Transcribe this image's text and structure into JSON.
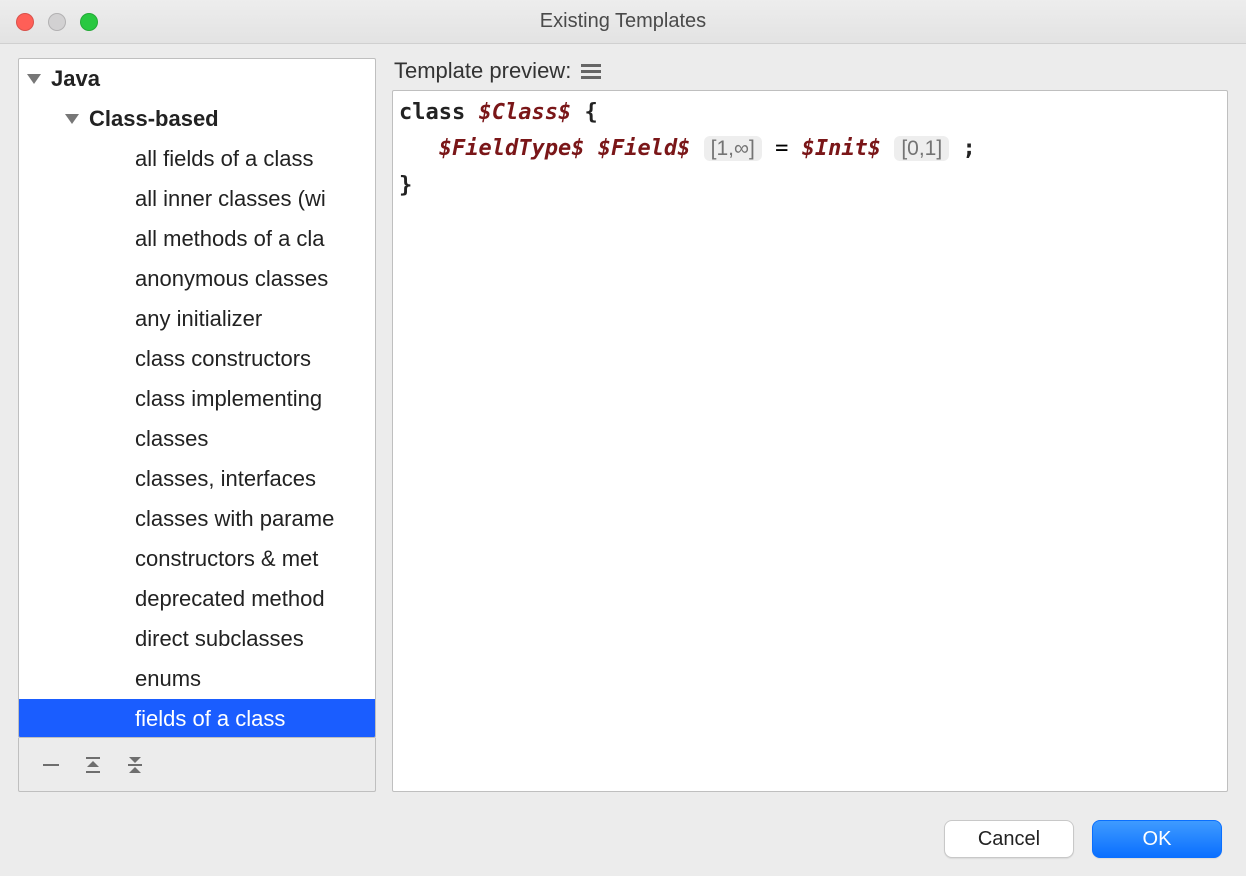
{
  "window": {
    "title": "Existing Templates"
  },
  "tree": {
    "root": {
      "label": "Java",
      "child": {
        "label": "Class-based",
        "items": [
          "all fields of a class",
          "all inner classes (wi",
          "all methods of a cla",
          "anonymous classes",
          "any initializer",
          "class constructors",
          "class implementing",
          "classes",
          "classes, interfaces ",
          "classes with parame",
          "constructors & met",
          "deprecated method",
          "direct subclasses",
          "enums",
          "fields of a class"
        ],
        "selected_index": 14
      }
    }
  },
  "preview": {
    "header": "Template preview:",
    "code": {
      "line1_kw": "class",
      "line1_var": "$Class$",
      "line1_brace": "{",
      "line2_var1": "$FieldType$",
      "line2_var2": "$Field$",
      "line2_c1": "[1,∞]",
      "line2_eq": " =",
      "line2_var3": "$Init$",
      "line2_c2": "[0,1]",
      "line2_semi": ";",
      "line3": "}"
    }
  },
  "buttons": {
    "cancel": "Cancel",
    "ok": "OK"
  }
}
